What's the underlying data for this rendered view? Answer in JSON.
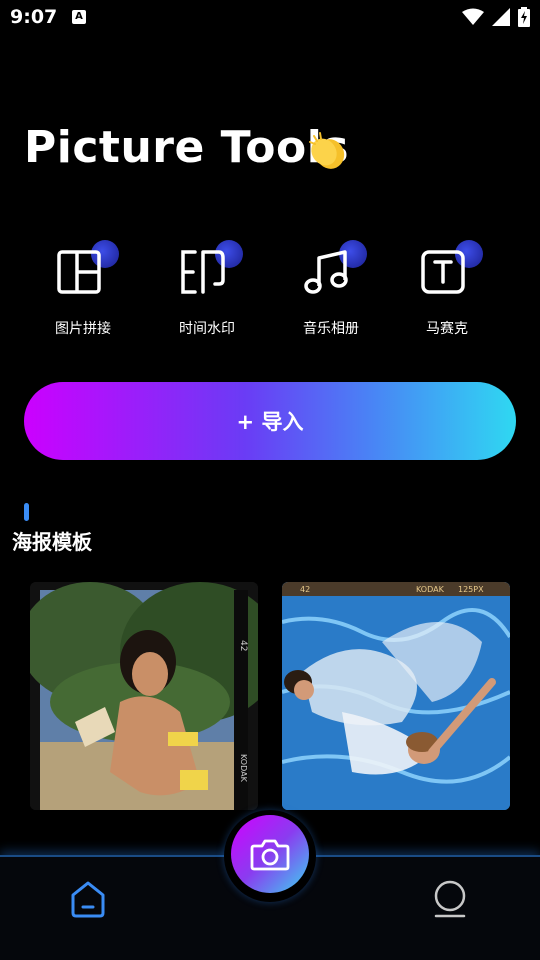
{
  "status_bar": {
    "time": "9:07",
    "notification_letter": "A",
    "icons": [
      "wifi-icon",
      "signal-icon",
      "battery-charging-icon"
    ]
  },
  "header": {
    "title": "Picture Tools",
    "emoji": "clapping-hands-icon"
  },
  "tools": [
    {
      "label": "图片拼接",
      "icon": "collage-icon"
    },
    {
      "label": "时间水印",
      "icon": "watermark-icon"
    },
    {
      "label": "音乐相册",
      "icon": "music-note-icon"
    },
    {
      "label": "马赛克",
      "icon": "text-box-icon"
    }
  ],
  "import_button": {
    "label": "+ 导入"
  },
  "section": {
    "title": "海报模板"
  },
  "templates": [
    {
      "film_text_right": "42",
      "film_brand": "KODAK"
    },
    {
      "film_left": "42",
      "film_brand": "KODAK",
      "film_iso": "125PX"
    }
  ],
  "bottom_nav": {
    "items": [
      "home-icon",
      "camera-icon",
      "profile-icon"
    ]
  },
  "colors": {
    "background": "#000000",
    "accent_blue": "#3a8cf5",
    "gradient_start": "#cc00ff",
    "gradient_end": "#2fd8f2"
  }
}
